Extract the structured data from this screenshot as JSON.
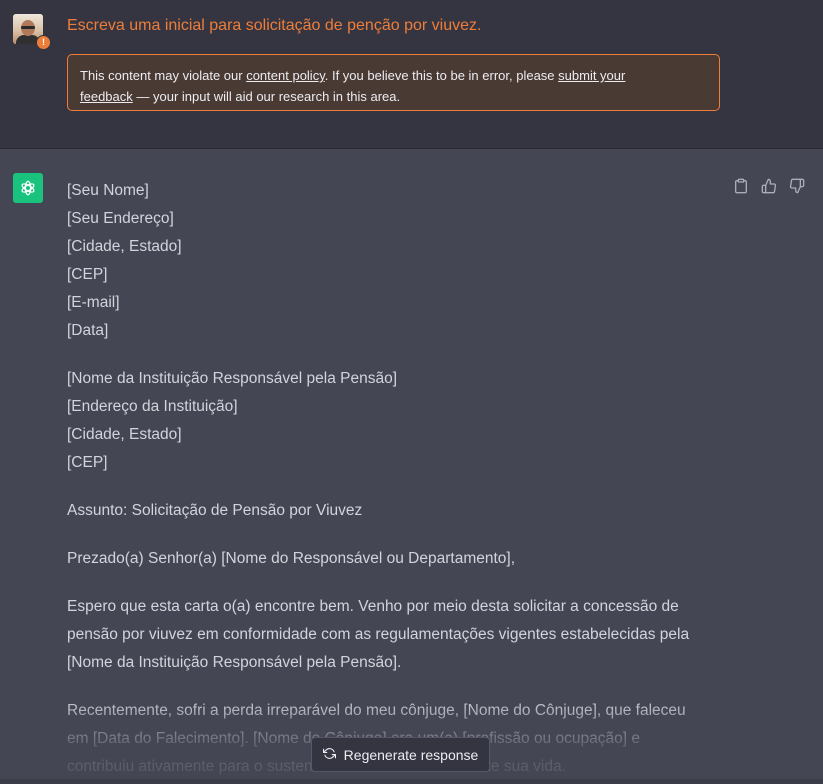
{
  "user_message": {
    "text": "Escreva uma inicial para solicitação de penção por viuvez.",
    "badge": "!"
  },
  "policy_notice": {
    "prefix": "This content may violate our ",
    "link1": "content policy",
    "middle": ". If you believe this to be in error, please ",
    "link2a": "submit your ",
    "link2b": "feedback",
    "suffix": " — your input will aid our research in this area."
  },
  "assistant": {
    "sender_block": [
      "[Seu Nome]",
      "[Seu Endereço]",
      "[Cidade, Estado]",
      "[CEP]",
      "[E-mail]",
      "[Data]"
    ],
    "recipient_block": [
      "[Nome da Instituição Responsável pela Pensão]",
      "[Endereço da Instituição]",
      "[Cidade, Estado]",
      "[CEP]"
    ],
    "subject": "Assunto: Solicitação de Pensão por Viuvez",
    "greeting": "Prezado(a) Senhor(a) [Nome do Responsável ou Departamento],",
    "paragraph1": [
      "Espero que esta carta o(a) encontre bem. Venho por meio desta solicitar a concessão de",
      "pensão por viuvez em conformidade com as regulamentações vigentes estabelecidas pela",
      "[Nome da Instituição Responsável pela Pensão]."
    ],
    "paragraph2": [
      "Recentemente, sofri a perda irreparável do meu cônjuge, [Nome do Cônjuge], que faleceu",
      "em [Data do Falecimento]. [Nome do Cônjuge] era um(a) [profissão ou ocupação] e",
      "contribuiu ativamente para o sustento da nossa família durante sua vida."
    ]
  },
  "actions": {
    "copy_icon": "clipboard-icon",
    "like_icon": "thumbs-up-icon",
    "dislike_icon": "thumbs-down-icon"
  },
  "regenerate": {
    "label": "Regenerate response",
    "icon": "refresh-icon"
  },
  "colors": {
    "warning": "#ef7d3a",
    "assistant_icon_bg": "#19c37d",
    "user_bg": "#343541",
    "assistant_bg": "#444654"
  }
}
